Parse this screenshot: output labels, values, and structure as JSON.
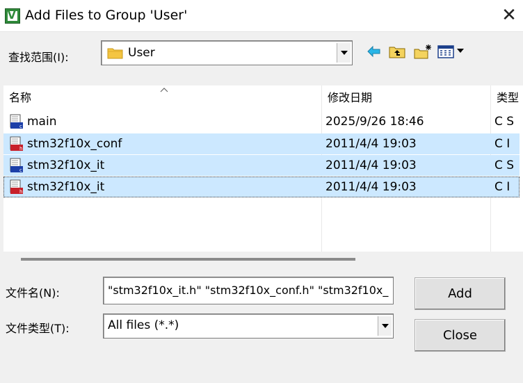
{
  "window": {
    "title": "Add Files to Group 'User'"
  },
  "look_in": {
    "label": "查找范围(I):",
    "value": "User"
  },
  "toolbar": {
    "back_icon": "back-arrow-icon",
    "up_icon": "up-folder-icon",
    "new_folder_icon": "new-folder-icon",
    "view_menu_icon": "view-menu-icon"
  },
  "list": {
    "columns": [
      "名称",
      "修改日期",
      "类型"
    ],
    "rows": [
      {
        "name": "main",
        "date": "2025/9/26 18:46",
        "type": "C S",
        "icon": "c-source-file-icon",
        "selected": false
      },
      {
        "name": "stm32f10x_conf",
        "date": "2011/4/4 19:03",
        "type": "C I",
        "icon": "c-header-file-icon",
        "selected": true
      },
      {
        "name": "stm32f10x_it",
        "date": "2011/4/4 19:03",
        "type": "C S",
        "icon": "c-source-file-icon",
        "selected": true
      },
      {
        "name": "stm32f10x_it",
        "date": "2011/4/4 19:03",
        "type": "C I",
        "icon": "c-header-file-icon",
        "selected": true
      }
    ]
  },
  "file_name": {
    "label": "文件名(N):",
    "value": "\"stm32f10x_it.h\" \"stm32f10x_conf.h\" \"stm32f10x_"
  },
  "file_type": {
    "label": "文件类型(T):",
    "value": "All files (*.*)"
  },
  "buttons": {
    "add": "Add",
    "close": "Close"
  },
  "colors": {
    "selection": "#cce8ff",
    "c_source_icon": "#1c3fa8",
    "c_header_icon": "#c8202a"
  }
}
